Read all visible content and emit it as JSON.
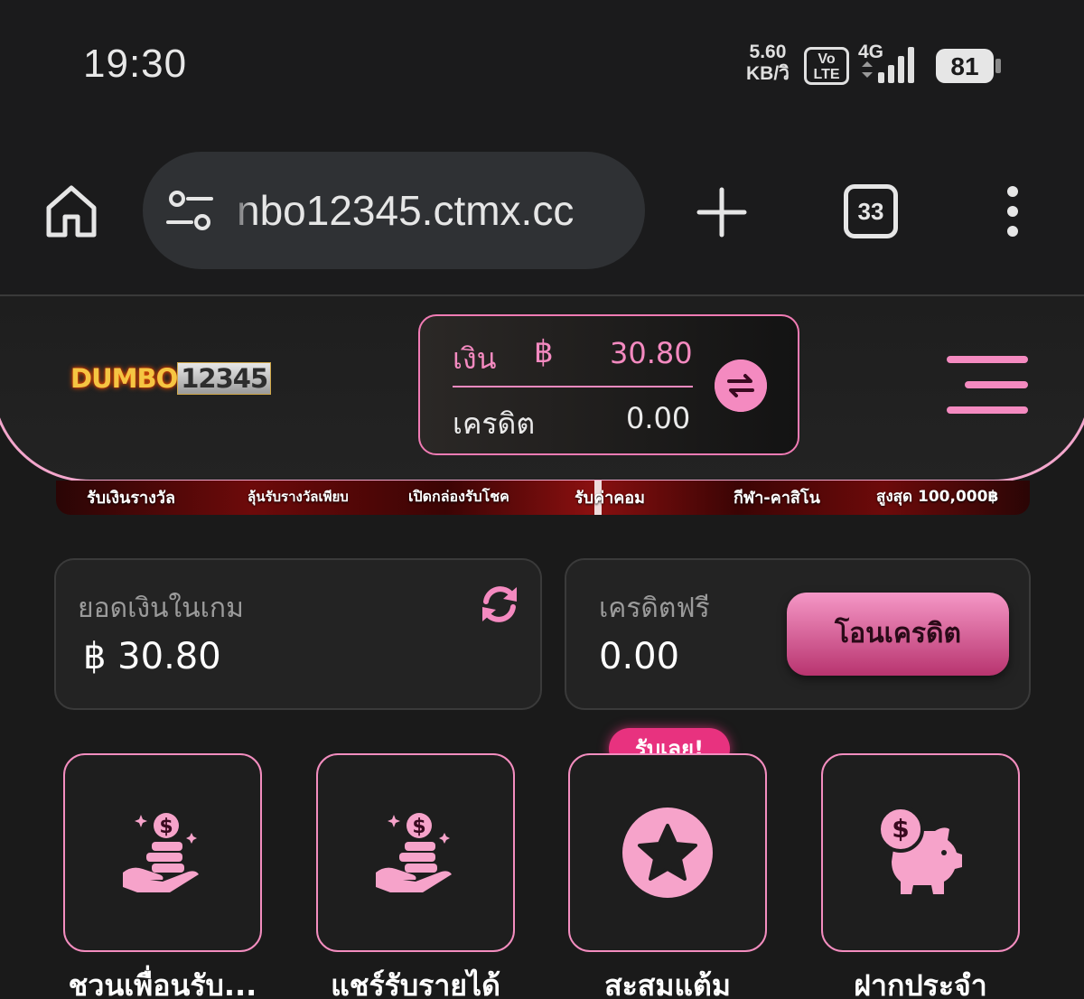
{
  "status_bar": {
    "time": "19:30",
    "net_speed_value": "5.60",
    "net_speed_unit": "KB/วิ",
    "volte_top": "Vo",
    "volte_bottom": "LTE",
    "network_type": "4G",
    "battery": "81",
    "icons": [
      "signal-icon",
      "battery-icon"
    ]
  },
  "browser": {
    "url": "nbo12345.ctmx.cc",
    "tab_count": "33",
    "icons": [
      "home-icon",
      "site-settings-icon",
      "plus-icon",
      "more-vert-icon"
    ]
  },
  "header": {
    "logo_part1": "DUMBO",
    "logo_part2": "12345",
    "money_label": "เงิน",
    "currency_symbol": "฿",
    "money_value": "30.80",
    "credit_label": "เครดิต",
    "credit_value": "0.00",
    "accent_color": "#f48ac0"
  },
  "promo": {
    "items": [
      "รับเงินรางวัล",
      "ลุ้นรับรางวัลเพียบ",
      "เปิดกล่องรับโชค",
      "รับค่าคอม",
      "กีฬา-คาสิโน",
      "สูงสุด 100,000฿"
    ]
  },
  "balance_card": {
    "label": "ยอดเงินในเกม",
    "value": "฿ 30.80"
  },
  "credit_card": {
    "label": "เครดิตฟรี",
    "value": "0.00",
    "button_label": "โอนเครดิต"
  },
  "features": {
    "badge": "รับเลย!",
    "tiles": [
      {
        "label": "ชวนเพื่อนรับ...",
        "icon": "coins-hand-icon"
      },
      {
        "label": "แชร์รับรายได้",
        "icon": "coins-hand-icon"
      },
      {
        "label": "สะสมแต้ม",
        "icon": "star-icon"
      },
      {
        "label": "ฝากประจำ",
        "icon": "piggy-bank-icon"
      }
    ]
  }
}
